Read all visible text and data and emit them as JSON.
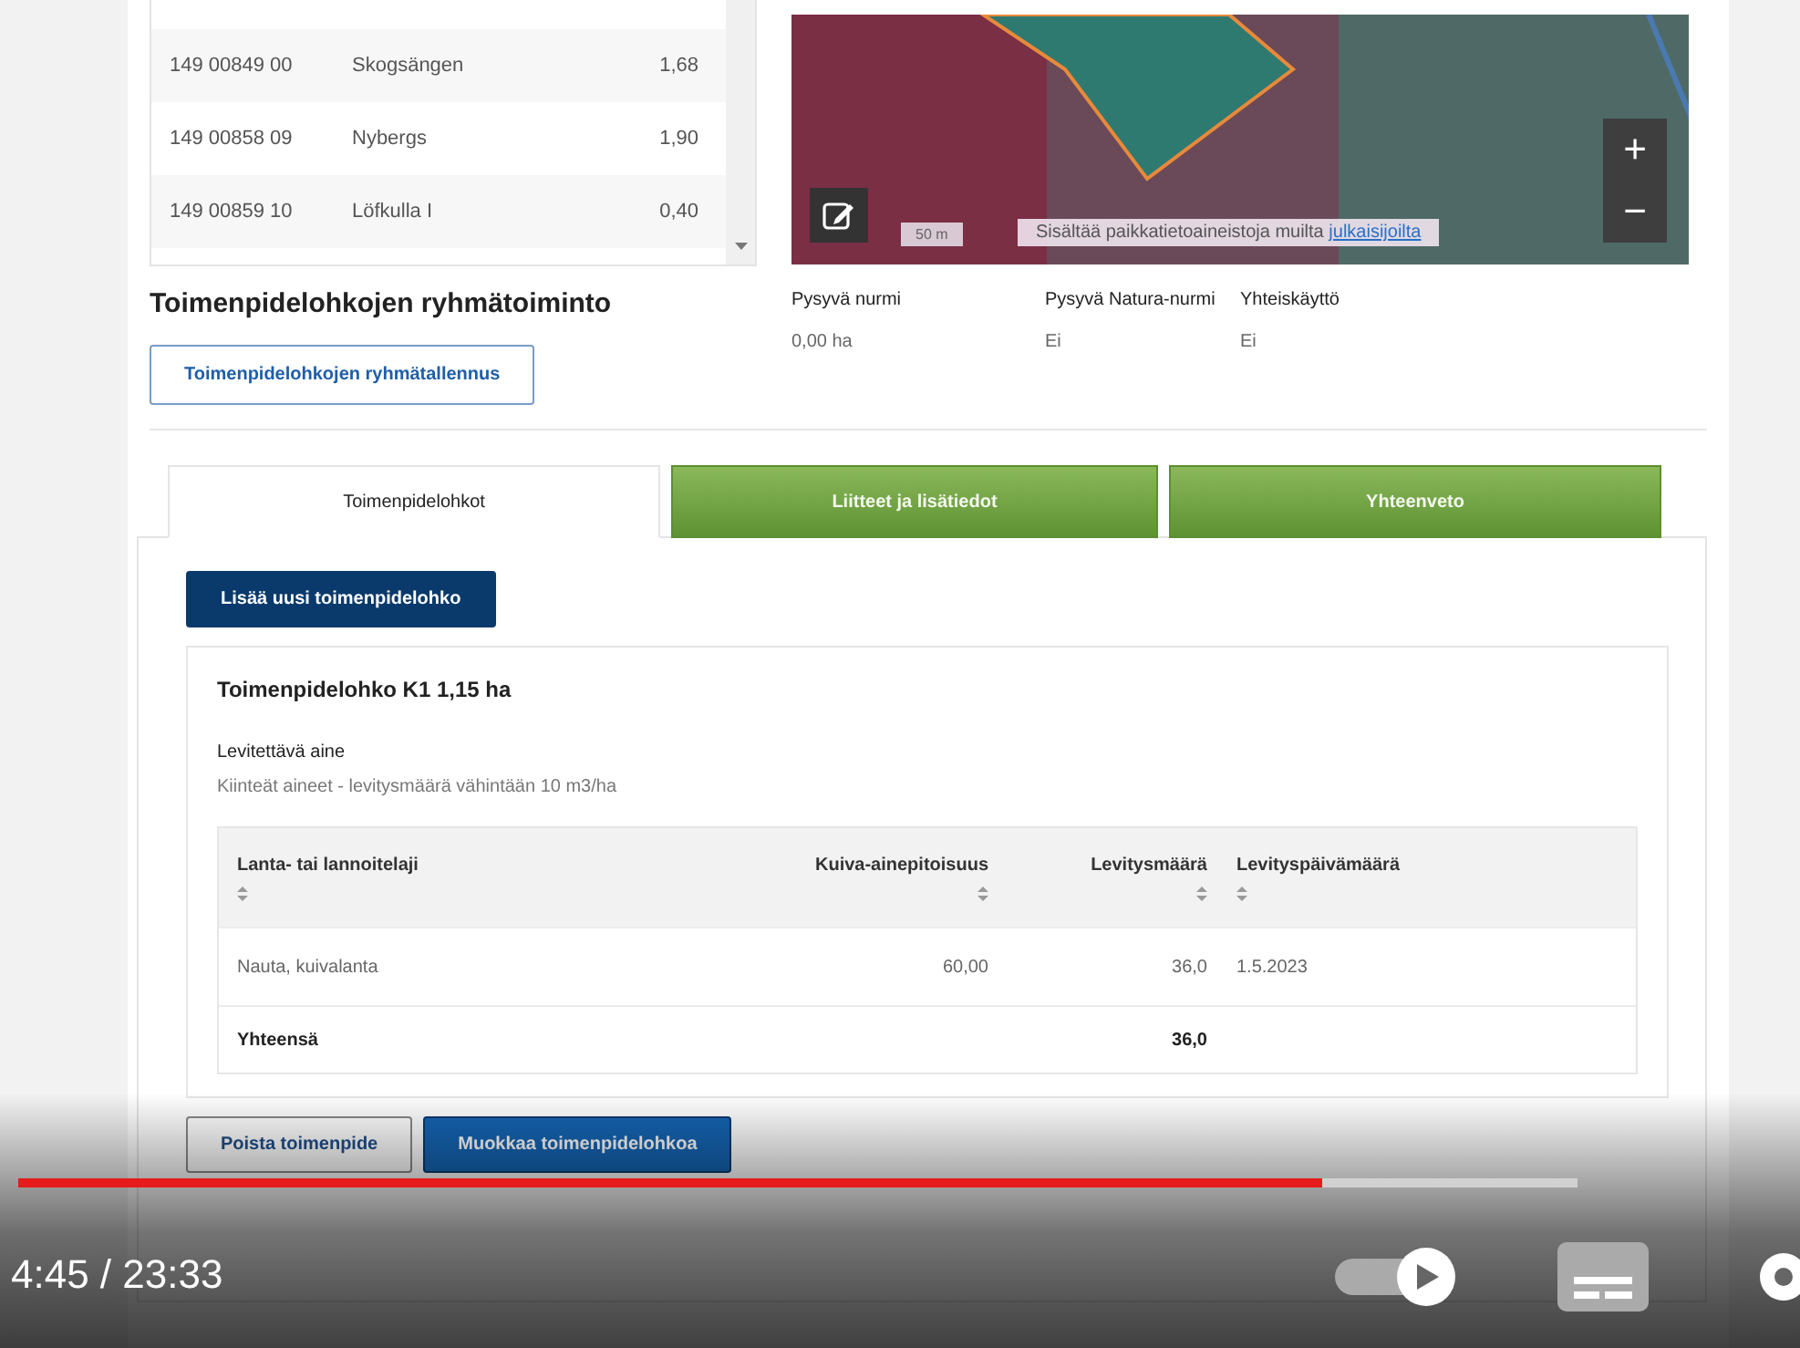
{
  "parcels_table": {
    "rows": [
      {
        "id": "149 00849 00",
        "name": "Skogsängen",
        "area": "1,68"
      },
      {
        "id": "149 00858 09",
        "name": "Nybergs",
        "area": "1,90"
      },
      {
        "id": "149 00859 10",
        "name": "Löfkulla I",
        "area": "0,40"
      }
    ]
  },
  "map": {
    "scale": "50 m",
    "attribution": "Sisältää paikkatietoaineistoja muilta",
    "attribution_link": "julkaisijoilta",
    "zoom_in": "+",
    "zoom_out": "−"
  },
  "group_action": {
    "title": "Toimenpidelohkojen ryhmätoiminto",
    "button": "Toimenpidelohkojen ryhmätallennus"
  },
  "info": [
    {
      "label": "Pysyvä nurmi",
      "value": "0,00 ha"
    },
    {
      "label": "Pysyvä Natura-nurmi",
      "value": "Ei"
    },
    {
      "label": "Yhteiskäyttö",
      "value": "Ei"
    }
  ],
  "tabs": [
    {
      "label": "Toimenpidelohkot",
      "selected": true
    },
    {
      "label": "Liitteet ja lisätiedot",
      "selected": false
    },
    {
      "label": "Yhteenveto",
      "selected": false
    }
  ],
  "add_button": "Lisää uusi toimenpidelohko",
  "block": {
    "title": "Toimenpidelohko K1 1,15 ha",
    "substance_label": "Levitettävä aine",
    "substance": "Kiinteät aineet - levitysmäärä vähintään 10 m3/ha",
    "table": {
      "columns": [
        "Lanta- tai lannoitelaji",
        "Kuiva-ainepitoisuus",
        "Levitysmäärä",
        "Levityspäivämäärä"
      ],
      "rows": [
        [
          "Nauta, kuivalanta",
          "60,00",
          "36,0",
          "1.5.2023"
        ]
      ],
      "total": {
        "label": "Yhteensä",
        "amount": "36,0"
      }
    }
  },
  "actions": [
    {
      "label": "Poista toimenpide",
      "kind": "secondary"
    },
    {
      "label": "Muokkaa toimenpidelohkoa",
      "kind": "primary"
    }
  ],
  "video": {
    "time": "4:45 / 23:33",
    "progress": {
      "level": 0.836
    }
  }
}
